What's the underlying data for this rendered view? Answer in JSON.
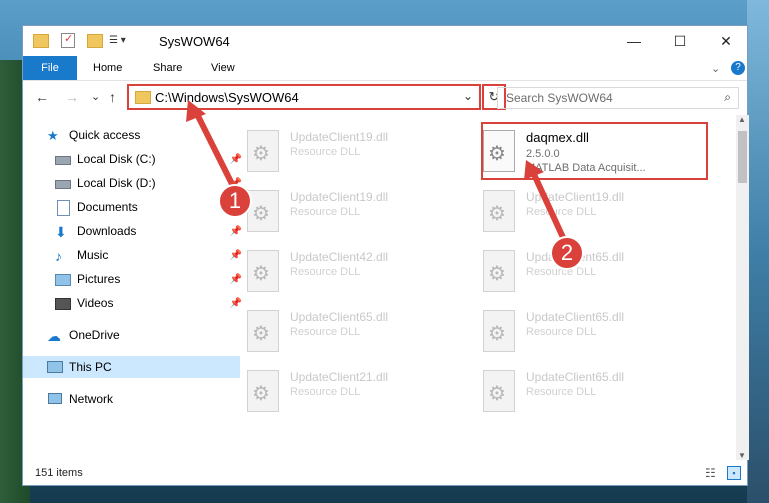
{
  "window": {
    "title": "SysWOW64",
    "minimize": "—",
    "maximize": "☐",
    "close": "✕"
  },
  "ribbon": {
    "file": "File",
    "home": "Home",
    "share": "Share",
    "view": "View",
    "collapse": "⌄",
    "help": "?"
  },
  "nav": {
    "back": "←",
    "forward": "→",
    "recent": "⌄",
    "up": "↑"
  },
  "address": {
    "path": "C:\\Windows\\SysWOW64",
    "dropdown": "⌄",
    "refresh": "↻"
  },
  "search": {
    "placeholder": "Search SysWOW64",
    "icon": "⌕"
  },
  "sidebar": {
    "items": [
      {
        "label": "Quick access",
        "icon": "star-icon"
      },
      {
        "label": "Local Disk (C:)",
        "icon": "drive-icon",
        "pinned": true
      },
      {
        "label": "Local Disk (D:)",
        "icon": "drive-icon",
        "pinned": true
      },
      {
        "label": "Documents",
        "icon": "documents-icon",
        "pinned": true
      },
      {
        "label": "Downloads",
        "icon": "downloads-icon",
        "pinned": true
      },
      {
        "label": "Music",
        "icon": "music-icon",
        "pinned": true
      },
      {
        "label": "Pictures",
        "icon": "pictures-icon",
        "pinned": true
      },
      {
        "label": "Videos",
        "icon": "videos-icon",
        "pinned": true
      },
      {
        "label": "OneDrive",
        "icon": "onedrive-icon"
      },
      {
        "label": "This PC",
        "icon": "this-pc-icon"
      },
      {
        "label": "Network",
        "icon": "network-icon"
      }
    ]
  },
  "files": {
    "left": [
      {
        "name": "UpdateClient19.dll",
        "type": "Resource DLL"
      },
      {
        "name": "UpdateClient19.dll",
        "type": "Resource DLL"
      },
      {
        "name": "UpdateClient42.dll",
        "type": "Resource DLL"
      },
      {
        "name": "UpdateClient65.dll",
        "type": "Resource DLL"
      },
      {
        "name": "UpdateClient21.dll",
        "type": "Resource DLL"
      }
    ],
    "right": [
      {
        "name": "daqmex.dll",
        "version": "2.5.0.0",
        "desc": "MATLAB Data Acquisit..."
      },
      {
        "name": "UpdateClient19.dll",
        "type": "Resource DLL"
      },
      {
        "name": "UpdateClient65.dll",
        "type": "Resource DLL"
      },
      {
        "name": "UpdateClient65.dll",
        "type": "Resource DLL"
      },
      {
        "name": "UpdateClient65.dll",
        "type": "Resource DLL"
      }
    ]
  },
  "status": {
    "items": "151 items"
  },
  "markers": {
    "one": "1",
    "two": "2"
  },
  "colors": {
    "accent": "#1979ca",
    "highlight": "#d9413a"
  }
}
